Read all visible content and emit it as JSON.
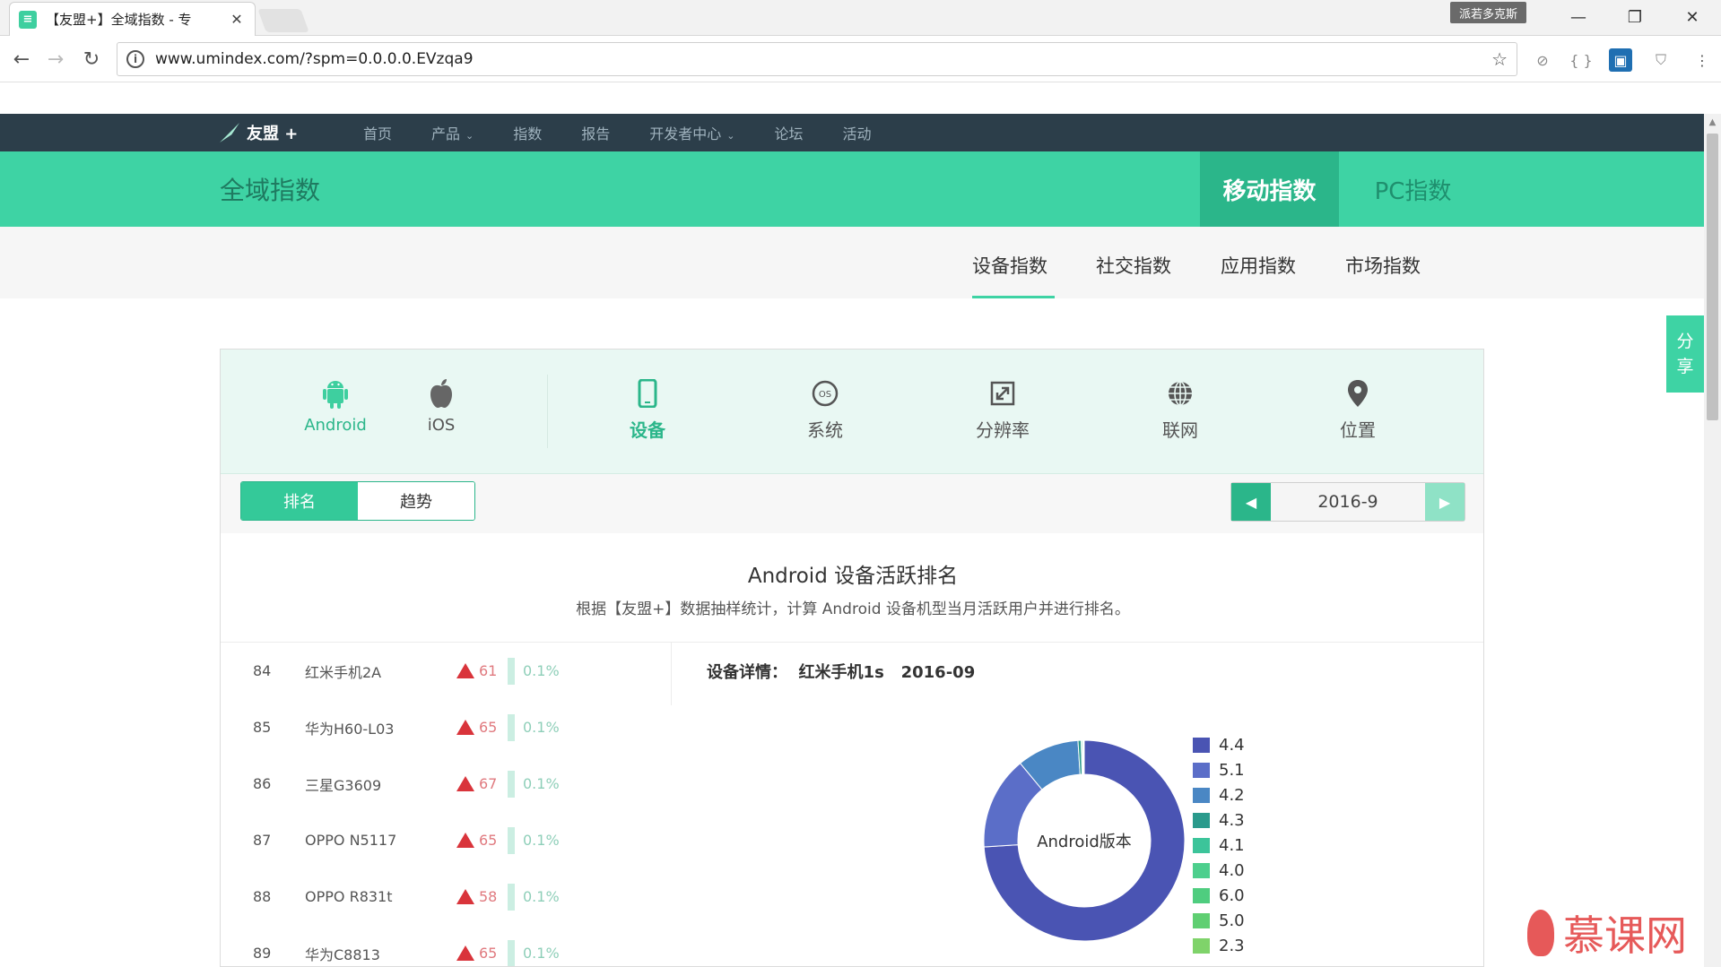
{
  "browser": {
    "tab_title": "【友盟+】全域指数 - 专",
    "favicon_letter": "≡",
    "user_badge": "派若多克斯",
    "url": "www.umindex.com/?spm=0.0.0.0.EVzqa9"
  },
  "site": {
    "logo_text": "友盟 +",
    "nav": [
      {
        "label": "首页"
      },
      {
        "label": "产品",
        "has_caret": true
      },
      {
        "label": "指数"
      },
      {
        "label": "报告"
      },
      {
        "label": "开发者中心",
        "has_caret": true
      },
      {
        "label": "论坛"
      },
      {
        "label": "活动"
      }
    ],
    "section_title": "全域指数",
    "top_tabs": {
      "mobile": "移动指数",
      "pc": "PC指数"
    },
    "sub_tabs": [
      "设备指数",
      "社交指数",
      "应用指数",
      "市场指数"
    ],
    "share_label_1": "分",
    "share_label_2": "享"
  },
  "panel": {
    "platforms": [
      {
        "label": "Android",
        "icon": "android-icon"
      },
      {
        "label": "iOS",
        "icon": "apple-icon"
      }
    ],
    "categories": [
      {
        "label": "设备",
        "icon": "phone-icon",
        "active": true
      },
      {
        "label": "系统",
        "icon": "os-icon"
      },
      {
        "label": "分辨率",
        "icon": "resize-icon"
      },
      {
        "label": "联网",
        "icon": "globe-icon"
      },
      {
        "label": "位置",
        "icon": "location-pin-icon"
      }
    ],
    "segment": {
      "rank": "排名",
      "trend": "趋势"
    },
    "date": "2016-9",
    "chart_title": "Android 设备活跃排名",
    "chart_desc": "根据【友盟+】数据抽样统计，计算 Android 设备机型当月活跃用户并进行排名。",
    "detail_label": "设备详情：",
    "detail_device": "红米手机1s",
    "detail_date": "2016-09",
    "rows": [
      {
        "rank": "84",
        "name": "红米手机2A",
        "change": "61",
        "pct": "0.1%"
      },
      {
        "rank": "85",
        "name": "华为H60-L03",
        "change": "65",
        "pct": "0.1%"
      },
      {
        "rank": "86",
        "name": "三星G3609",
        "change": "67",
        "pct": "0.1%"
      },
      {
        "rank": "87",
        "name": "OPPO N5117",
        "change": "65",
        "pct": "0.1%"
      },
      {
        "rank": "88",
        "name": "OPPO R831t",
        "change": "58",
        "pct": "0.1%"
      },
      {
        "rank": "89",
        "name": "华为C8813",
        "change": "65",
        "pct": "0.1%"
      }
    ]
  },
  "chart_data": {
    "type": "pie",
    "title": "Android版本",
    "categories": [
      "4.4",
      "5.1",
      "4.2",
      "4.3",
      "4.1",
      "4.0",
      "6.0",
      "5.0",
      "2.3"
    ],
    "values": [
      74,
      15,
      10,
      0.5,
      0.2,
      0.1,
      0.1,
      0.05,
      0.05
    ],
    "colors": [
      "#4a54b3",
      "#5b6ec8",
      "#4a87c4",
      "#2a9a8c",
      "#3cc49a",
      "#4dcf8d",
      "#4fcd7f",
      "#5fcf72",
      "#7fd36a"
    ],
    "legend_position": "right"
  },
  "watermark": {
    "text": "慕课网"
  }
}
